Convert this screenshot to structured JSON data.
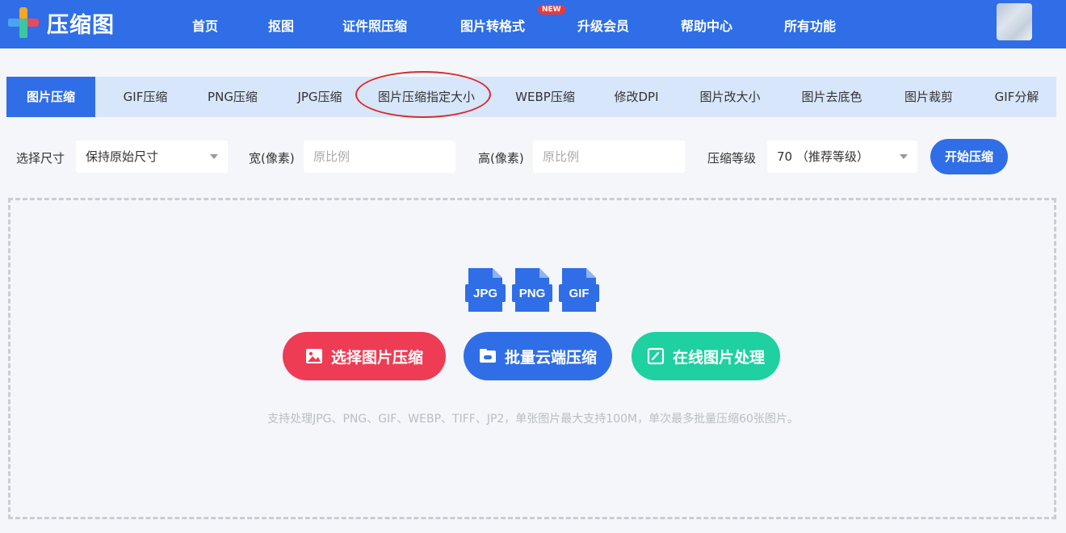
{
  "app": {
    "name": "压缩图"
  },
  "nav": {
    "items": [
      "首页",
      "抠图",
      "证件照压缩",
      "图片转格式",
      "升级会员",
      "帮助中心",
      "所有功能"
    ],
    "new_badge": "NEW"
  },
  "tabs": {
    "items": [
      "图片压缩",
      "GIF压缩",
      "PNG压缩",
      "JPG压缩",
      "图片压缩指定大小",
      "WEBP压缩",
      "修改DPI",
      "图片改大小",
      "图片去底色",
      "图片裁剪",
      "GIF分解"
    ],
    "active_index": 0,
    "circled_index": 4
  },
  "options": {
    "size_label": "选择尺寸",
    "size_value": "保持原始尺寸",
    "width_label": "宽(像素)",
    "width_placeholder": "原比例",
    "height_label": "高(像素)",
    "height_placeholder": "原比例",
    "level_label": "压缩等级",
    "level_value": "70 （推荐等级）",
    "start_button": "开始压缩"
  },
  "upload": {
    "file_types": [
      "JPG",
      "PNG",
      "GIF"
    ],
    "buttons": {
      "select": "选择图片压缩",
      "batch": "批量云端压缩",
      "online": "在线图片处理"
    },
    "hint": "支持处理JPG、PNG、GIF、WEBP、TIFF、JP2，单张图片最大支持100M，单次最多批量压缩60张图片。"
  },
  "colors": {
    "brand": "#2f6ee6",
    "tab_bg": "#d7e6fa",
    "select_button": "#ee3c55",
    "batch_button": "#2f6ee6",
    "online_button": "#1fd0a0",
    "highlight_ring": "#d82a2a"
  }
}
